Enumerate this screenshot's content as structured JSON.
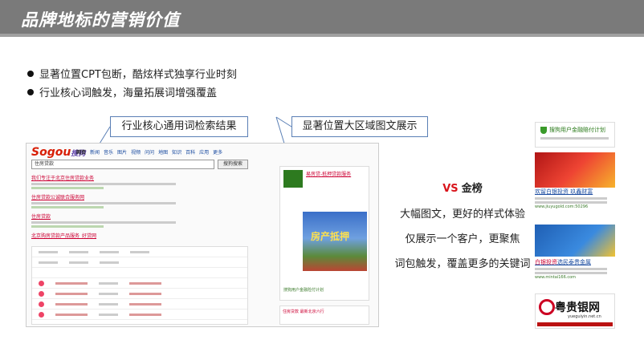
{
  "header": {
    "title": "品牌地标的营销价值"
  },
  "bullets": [
    "显著位置CPT包断，酷炫样式独享行业时刻",
    "行业核心词触发，海量拓展词增强覆盖"
  ],
  "callouts": {
    "left": "行业核心通用词检索结果",
    "right": "显著位置大区域图文展示"
  },
  "serp": {
    "logo": {
      "a": "Sogou",
      "b": "搜狗"
    },
    "nav": [
      "网页",
      "新闻",
      "音乐",
      "图片",
      "视频",
      "问问",
      "地图",
      "知识",
      "百科",
      "应用",
      "更多"
    ],
    "query": "住房贷款",
    "search_button": "搜狗搜索",
    "results": [
      "我们专注于北京住房贷款业务",
      "住房贷款公诚联合服务网",
      "住房贷款",
      "北京购房贷款产品服务_好贷网"
    ],
    "ad_title": "易房贷-抵押贷款服务",
    "ad_image_text": "房产抵押",
    "ad_footer": "搜狗用户金融险付计划",
    "ad2_text": "住房贷款 最新北京六行"
  },
  "compare": {
    "vs": "VS",
    "gold": "金榜",
    "lines": [
      "大幅图文，更好的样式体验",
      "仅展示一个客户，更聚焦",
      "词包触发，覆盖更多的关键词"
    ]
  },
  "right_col": {
    "plan_title": "搜狗用户金融赔付计划",
    "link1": "欢留白银投资 玖鑫财富",
    "link1_url": "www.jiuyugold.com:50296",
    "link2_red": "白银投资",
    "link2": "选民泰贵金属",
    "link2_url": "www.mintai166.com",
    "brand": "粤贵银网",
    "brand_url": "yueguiyin.net.cn"
  }
}
